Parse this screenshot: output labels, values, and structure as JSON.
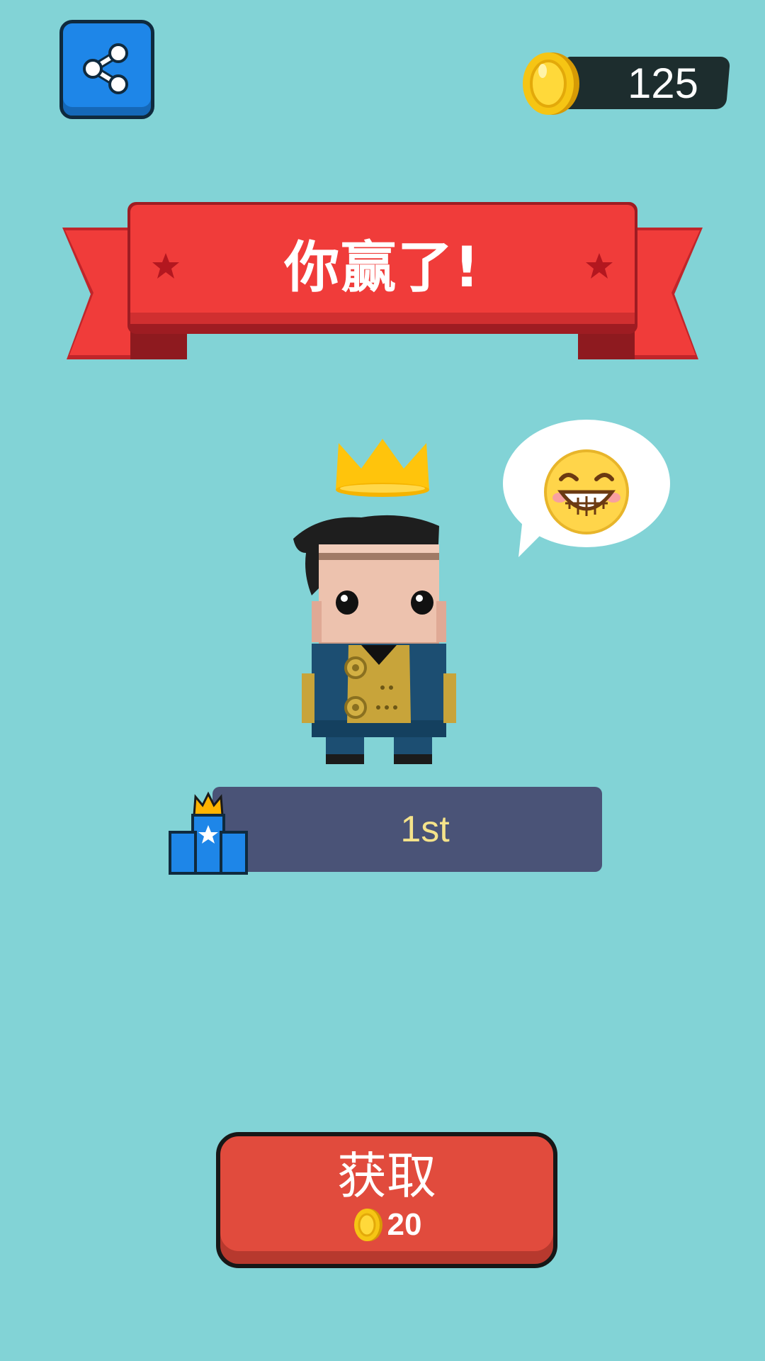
{
  "header": {
    "coins": "125"
  },
  "banner": {
    "title": "你赢了!"
  },
  "character": {
    "emote": "grinning-face"
  },
  "result": {
    "rank": "1st"
  },
  "get_button": {
    "label": "获取",
    "reward": "20"
  },
  "colors": {
    "background": "#82D3D6",
    "banner_red": "#F03C3A",
    "share_blue": "#1E86E8",
    "rank_bar": "#4A5377",
    "rank_text": "#F5E38A",
    "button_red": "#E14B3D",
    "coin_gold": "#F6C514"
  }
}
